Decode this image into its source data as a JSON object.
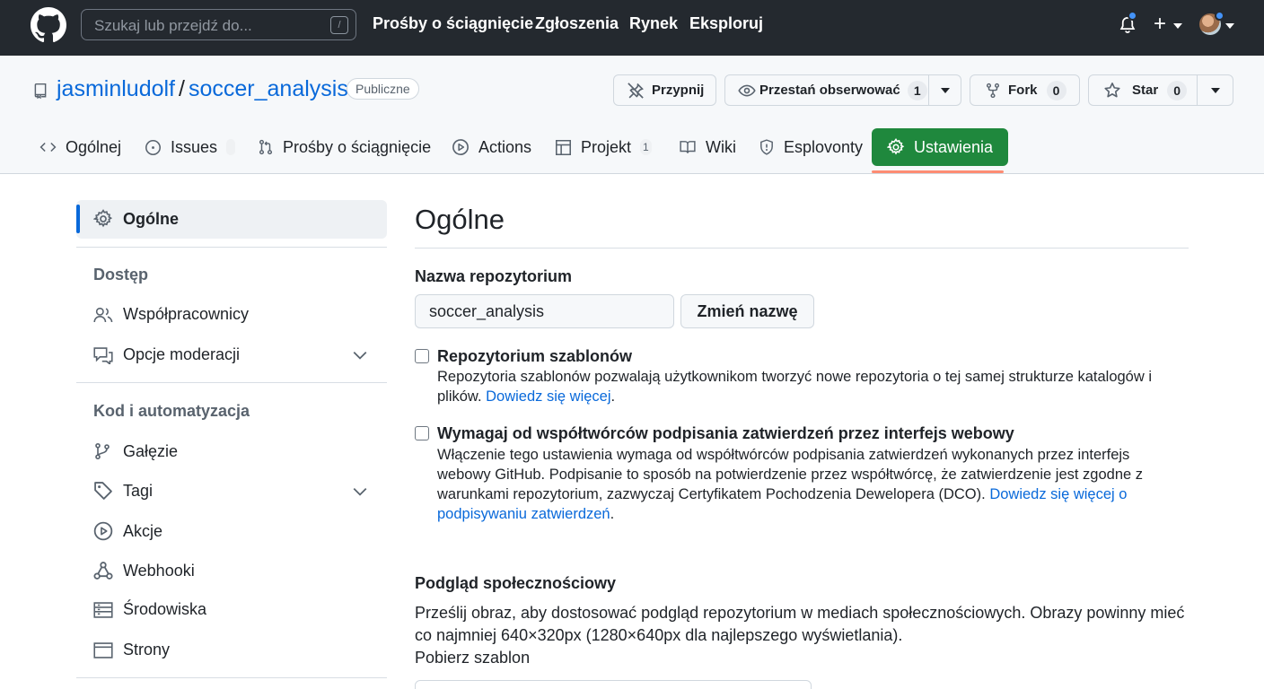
{
  "topbar": {
    "search_placeholder": "Szukaj lub przejdź do...",
    "slash_key": "/",
    "nav": [
      "Prośby o ściągnięcie",
      "Zgłoszenia",
      "Rynek",
      "Eksploruj"
    ],
    "plus": "+"
  },
  "repo": {
    "owner": "jasminludolf",
    "separator": "/",
    "name": "soccer_analysis",
    "visibility": "Publiczne",
    "actions": {
      "pin_label": "Przypnij",
      "unwatch_label": "Przestań obserwować",
      "watch_count": "1",
      "fork_label": "Fork",
      "fork_count": "0",
      "star_label": "Star",
      "star_count": "0"
    }
  },
  "tabs": [
    {
      "label": "Ogólnej",
      "icon": "code-icon"
    },
    {
      "label": "Issues",
      "icon": "issue-icon",
      "count": ""
    },
    {
      "label": "Prośby o ściągnięcie",
      "icon": "pull-request-icon"
    },
    {
      "label": "Actions",
      "icon": "play-icon"
    },
    {
      "label": "Projekt",
      "icon": "table-icon",
      "count": "1"
    },
    {
      "label": "Wiki",
      "icon": "book-icon"
    },
    {
      "label": "Esplovonty",
      "icon": "shield-icon"
    },
    {
      "label": "Ustawienia",
      "icon": "gear-icon",
      "active": true
    }
  ],
  "sidebar": {
    "active_label": "Ogólne",
    "section_access": "Dostęp",
    "access_items": [
      "Współpracownicy",
      "Opcje moderacji"
    ],
    "section_code": "Kod i automatyzacja",
    "code_items": [
      "Gałęzie",
      "Tagi",
      "Akcje",
      "Webhooki",
      "Środowiska",
      "Strony"
    ]
  },
  "main": {
    "title": "Ogólne",
    "repo_name_label": "Nazwa repozytorium",
    "repo_name_value": "soccer_analysis",
    "rename_button": "Zmień nazwę",
    "template": {
      "label": "Repozytorium szablonów",
      "desc": "Repozytoria szablonów pozwalają użytkownikom tworzyć nowe repozytoria o tej samej strukturze katalogów i plików.",
      "link": "Dowiedz się więcej",
      "link_suffix": "."
    },
    "signoff": {
      "label": "Wymagaj od współtwórców podpisania zatwierdzeń przez interfejs webowy",
      "desc": "Włączenie tego ustawienia wymaga od współtwórców podpisania zatwierdzeń wykonanych przez interfejs webowy GitHub. Podpisanie to sposób na potwierdzenie przez współtwórcę, że zatwierdzenie jest zgodne z warunkami repozytorium, zazwyczaj Certyfikatem Pochodzenia Dewelopera (DCO).",
      "link": "Dowiedz się więcej o podpisywaniu zatwierdzeń",
      "link_suffix": "."
    },
    "social": {
      "heading": "Podgląd społecznościowy",
      "desc": "Prześlij obraz, aby dostosować podgląd repozytorium w mediach społecznościowych. Obrazy powinny mieć co najmniej 640×320px (1280×640px dla najlepszego wyświetlania).",
      "link": "Pobierz szablon"
    }
  },
  "colors": {
    "topbar_bg": "#24292f",
    "link": "#0969da",
    "active_tab": "#1f883d",
    "tab_underline": "#fd8c73",
    "notification_dot": "#4493f8"
  }
}
